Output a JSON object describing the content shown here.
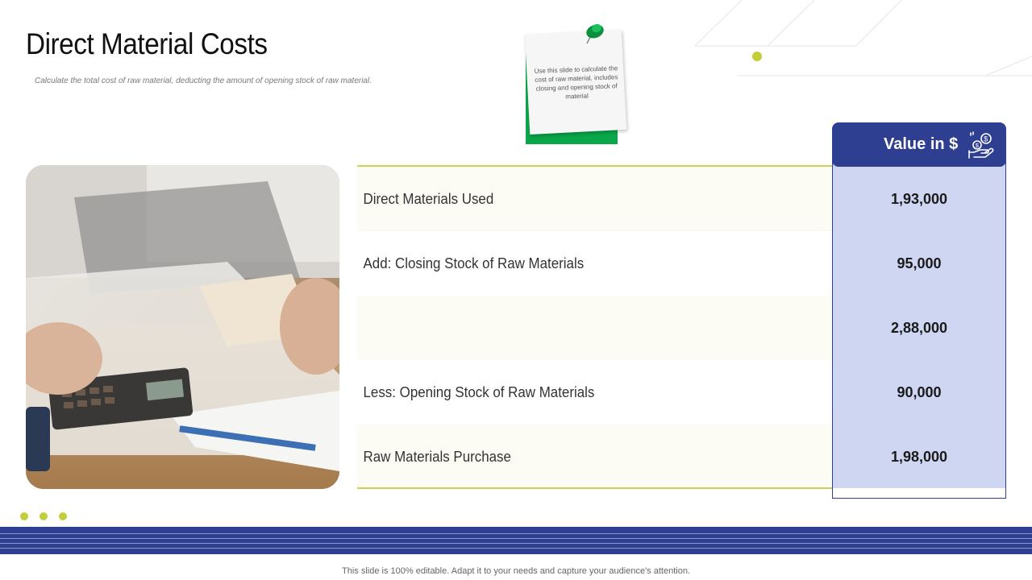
{
  "slide": {
    "title": "Direct Material Costs",
    "subtitle": "Calculate the total cost of raw material, deducting the amount of opening stock of raw material.",
    "note_text": "Use this slide to calculate the cost of raw material, includes closing and opening stock of material",
    "footer": "This slide is 100% editable. Adapt it to your needs and capture your audience's attention."
  },
  "table": {
    "value_header": "Value in $",
    "rows": [
      {
        "label": "Direct Materials Used",
        "value": "1,93,000"
      },
      {
        "label": "Add: Closing Stock of Raw Materials",
        "value": "95,000"
      },
      {
        "label": "",
        "value": "2,88,000"
      },
      {
        "label": "Less: Opening Stock of Raw Materials",
        "value": "90,000"
      },
      {
        "label": "Raw Materials Purchase",
        "value": "1,98,000"
      }
    ]
  },
  "colors": {
    "navy": "#2e3f92",
    "lime": "#c2cf3a",
    "value_fill": "#cfd6f1",
    "note_green": "#0aa64a"
  },
  "icons": {
    "pin": "pushpin-icon",
    "money": "money-hand-icon"
  }
}
